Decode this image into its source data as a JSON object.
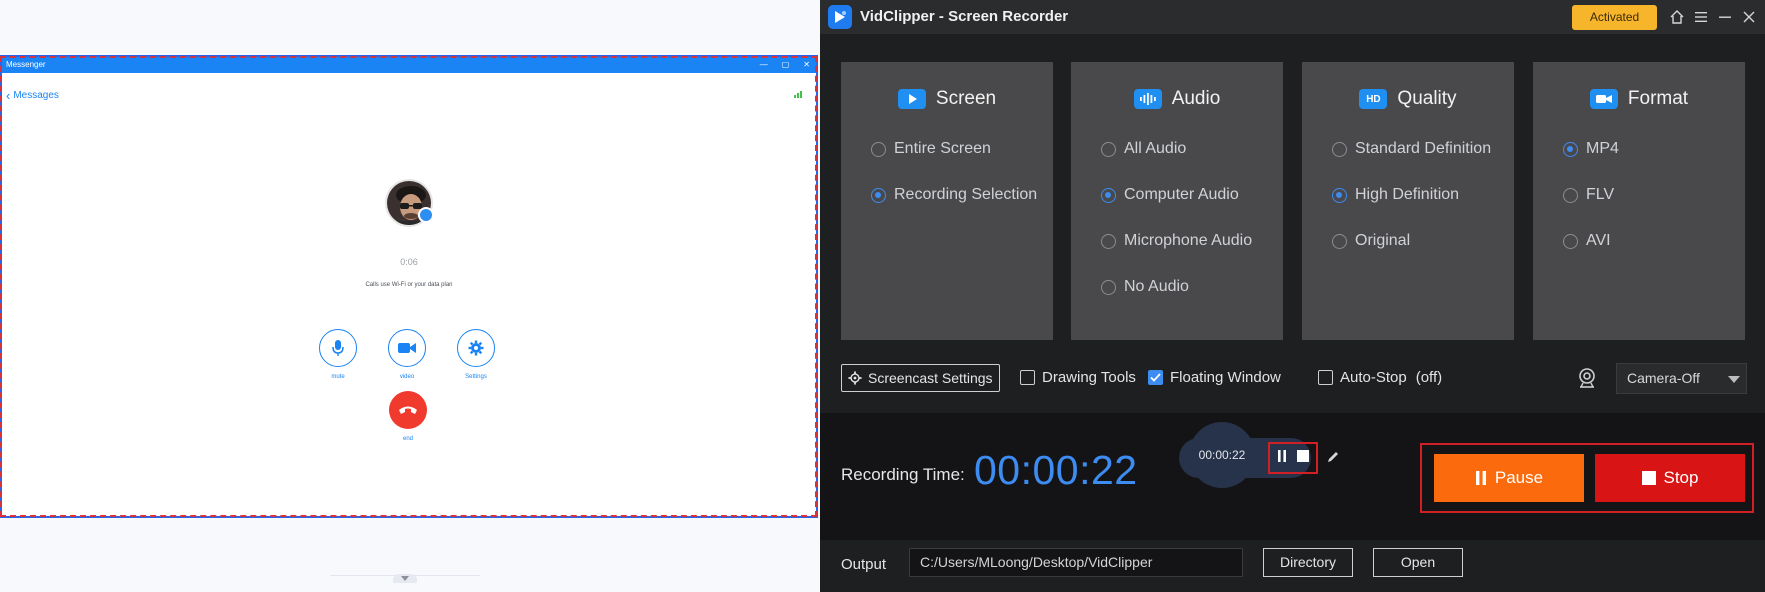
{
  "messenger": {
    "window_title": "Messenger",
    "back_label": "Messages",
    "call_timer": "0:06",
    "call_note": "Calls use Wi-Fi or your data plan",
    "buttons": [
      {
        "label": "mute",
        "icon": "microphone-icon"
      },
      {
        "label": "video",
        "icon": "video-camera-icon"
      },
      {
        "label": "Settings",
        "icon": "gear-icon"
      }
    ],
    "end_label": "end",
    "colors": {
      "accent": "#1a84f4",
      "end": "#f03a2e"
    }
  },
  "app": {
    "title": "VidClipper - Screen Recorder",
    "activated_label": "Activated",
    "colors": {
      "accent": "#3d8cf2",
      "pause": "#fb6b0d",
      "stop": "#d81414",
      "activated": "#f7b52b"
    }
  },
  "cards": {
    "screen": {
      "title": "Screen",
      "options": [
        {
          "label": "Entire Screen",
          "selected": false
        },
        {
          "label": "Recording Selection",
          "selected": true
        }
      ]
    },
    "audio": {
      "title": "Audio",
      "options": [
        {
          "label": "All Audio",
          "selected": false
        },
        {
          "label": "Computer Audio",
          "selected": true
        },
        {
          "label": "Microphone Audio",
          "selected": false
        },
        {
          "label": "No Audio",
          "selected": false
        }
      ]
    },
    "quality": {
      "title": "Quality",
      "icon_text": "HD",
      "options": [
        {
          "label": "Standard Definition",
          "selected": false
        },
        {
          "label": "High Definition",
          "selected": true
        },
        {
          "label": "Original",
          "selected": false
        }
      ]
    },
    "format": {
      "title": "Format",
      "options": [
        {
          "label": "MP4",
          "selected": true
        },
        {
          "label": "FLV",
          "selected": false
        },
        {
          "label": "AVI",
          "selected": false
        }
      ]
    }
  },
  "toolbar": {
    "screencast_settings": "Screencast Settings",
    "drawing_tools": {
      "label": "Drawing Tools",
      "checked": false
    },
    "floating_window": {
      "label": "Floating Window",
      "checked": true
    },
    "auto_stop": {
      "label": "Auto-Stop",
      "value": "(off)",
      "checked": false
    },
    "camera": "Camera-Off"
  },
  "recording": {
    "label": "Recording Time:",
    "time": "00:00:22",
    "float_time": "00:00:22",
    "pause_label": "Pause",
    "stop_label": "Stop"
  },
  "output": {
    "label": "Output",
    "path": "C:/Users/MLoong/Desktop/VidClipper",
    "directory_label": "Directory",
    "open_label": "Open"
  }
}
